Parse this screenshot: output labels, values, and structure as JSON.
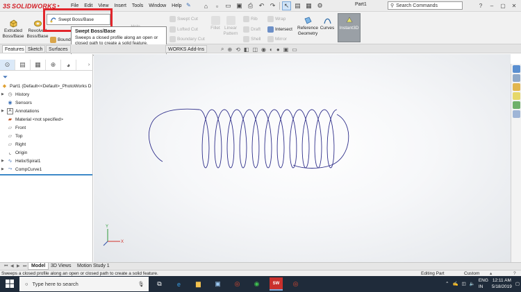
{
  "app": {
    "brand": "SOLIDWORKS",
    "brand_prefix": "3S",
    "document_title": "Part1"
  },
  "menu": [
    "File",
    "Edit",
    "View",
    "Insert",
    "Tools",
    "Window",
    "Help"
  ],
  "search": {
    "placeholder": "Search Commands"
  },
  "ribbon": {
    "extruded": "Extruded\nBoss/Base",
    "revolved": "Revolved\nBoss/Base",
    "swept_menu_item": "Swept Boss/Base",
    "boundary_partial": "Boundary Boss/Base",
    "swept_cut": "Swept Cut",
    "lofted_cut": "Lofted Cut",
    "boundary_cut": "Boundary Cut",
    "hole": "Hole",
    "fillet": "Fillet",
    "linear_pattern": "Linear\nPattern",
    "rib": "Rib",
    "draft": "Draft",
    "shell": "Shell",
    "wrap": "Wrap",
    "intersect": "Intersect",
    "mirror": "Mirror",
    "reference_geometry": "Reference\nGeometry",
    "curves": "Curves",
    "instant3d": "Instant3D"
  },
  "tooltip": {
    "title": "Swept Boss/Base",
    "body": "Sweeps a closed profile along an open or closed path to create a solid feature."
  },
  "command_tabs": {
    "features": "Features",
    "sketch": "Sketch",
    "surfaces": "Surfaces",
    "addins_partial": "WORKS Add-Ins"
  },
  "tree": {
    "root": "Part1  (Default<<Default>_PhotoWorks D",
    "items": [
      {
        "label": "History",
        "expandable": true
      },
      {
        "label": "Sensors",
        "expandable": false
      },
      {
        "label": "Annotations",
        "expandable": true
      },
      {
        "label": "Material <not specified>",
        "expandable": false
      },
      {
        "label": "Front",
        "expandable": false
      },
      {
        "label": "Top",
        "expandable": false
      },
      {
        "label": "Right",
        "expandable": false
      },
      {
        "label": "Origin",
        "expandable": false
      },
      {
        "label": "Helix/Spiral1",
        "expandable": true
      },
      {
        "label": "CompCurve1",
        "expandable": true
      }
    ]
  },
  "bottom_tabs": {
    "model": "Model",
    "views_3d": "3D Views",
    "motion": "Motion Study 1"
  },
  "status": {
    "message": "Sweeps a closed profile along an open or closed path to create a solid feature.",
    "mode": "Editing Part",
    "units": "Custom"
  },
  "taskbar": {
    "search_placeholder": "Type here to search",
    "lang_top": "ENG",
    "lang_bottom": "IN",
    "time": "12:11 AM",
    "date": "5/18/2019"
  },
  "colors": {
    "highlight_box": "#e2252b",
    "helix": "#2e2e8a",
    "accent": "#3d89c8"
  }
}
